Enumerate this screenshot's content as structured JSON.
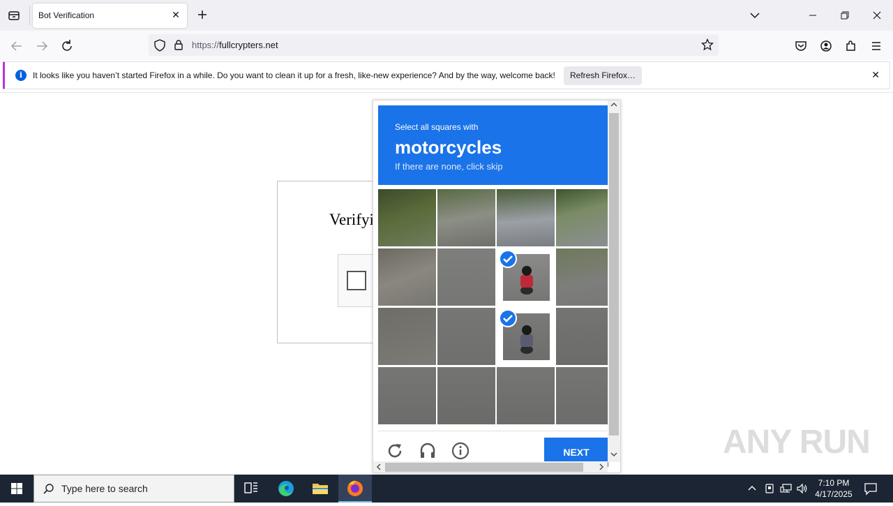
{
  "browser": {
    "tab_title": "Bot Verification",
    "url_prefix": "https://",
    "url_domain": "fullcrypters.net"
  },
  "notification": {
    "text": "It looks like you haven’t started Firefox in a while. Do you want to clean it up for a fresh, like-new experience? And by the way, welcome back!",
    "button_label": "Refresh Firefox…"
  },
  "page": {
    "verify_title": "Verifyi"
  },
  "captcha": {
    "instruction_small": "Select all squares with",
    "target": "motorcycles",
    "skip_hint": "If there are none, click skip",
    "next_label": "NEXT",
    "selected_cells": [
      6,
      10
    ]
  },
  "watermark": "ANY RUN",
  "taskbar": {
    "search_placeholder": "Type here to search",
    "time": "7:10 PM",
    "date": "4/17/2025"
  }
}
